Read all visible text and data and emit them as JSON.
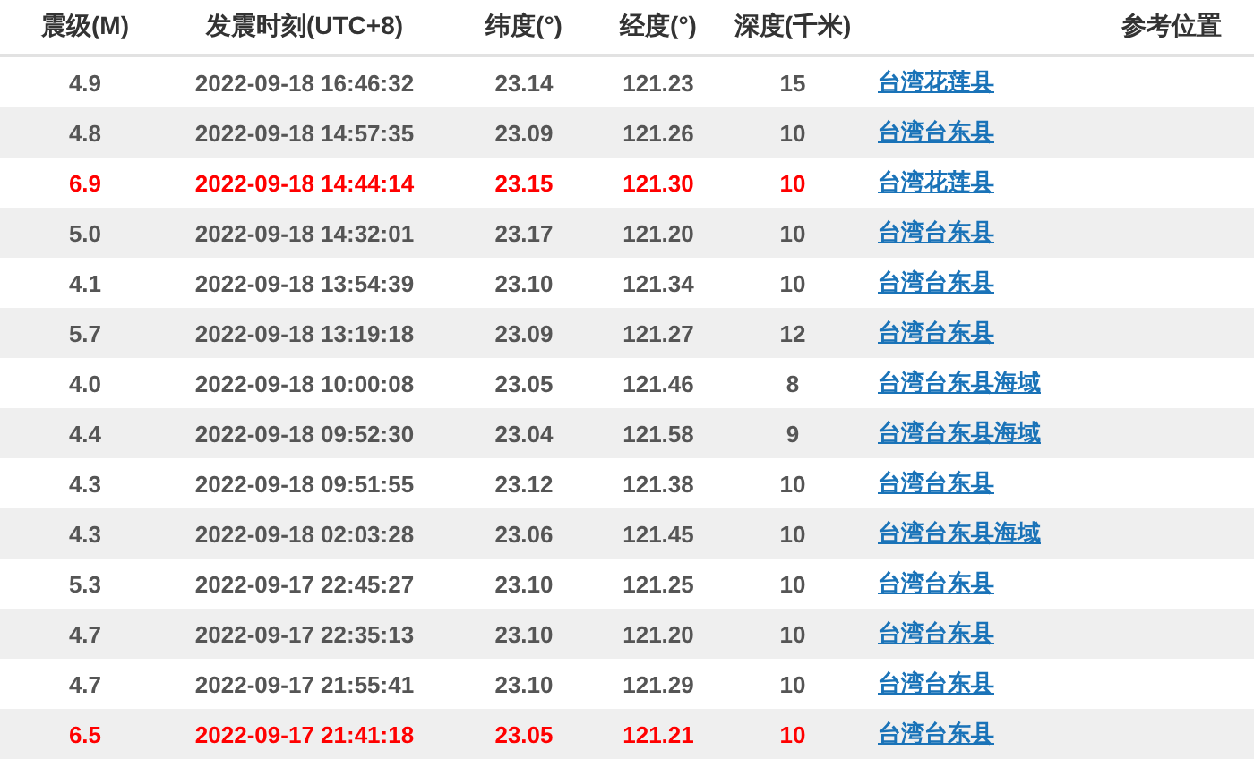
{
  "columns": [
    "震级(M)",
    "发震时刻(UTC+8)",
    "纬度(°)",
    "经度(°)",
    "深度(千米)",
    "参考位置"
  ],
  "rows": [
    {
      "magnitude": "4.9",
      "time": "2022-09-18 16:46:32",
      "latitude": "23.14",
      "longitude": "121.23",
      "depth": "15",
      "location": "台湾花莲县",
      "highlighted": false
    },
    {
      "magnitude": "4.8",
      "time": "2022-09-18 14:57:35",
      "latitude": "23.09",
      "longitude": "121.26",
      "depth": "10",
      "location": "台湾台东县",
      "highlighted": false
    },
    {
      "magnitude": "6.9",
      "time": "2022-09-18 14:44:14",
      "latitude": "23.15",
      "longitude": "121.30",
      "depth": "10",
      "location": "台湾花莲县",
      "highlighted": true
    },
    {
      "magnitude": "5.0",
      "time": "2022-09-18 14:32:01",
      "latitude": "23.17",
      "longitude": "121.20",
      "depth": "10",
      "location": "台湾台东县",
      "highlighted": false
    },
    {
      "magnitude": "4.1",
      "time": "2022-09-18 13:54:39",
      "latitude": "23.10",
      "longitude": "121.34",
      "depth": "10",
      "location": "台湾台东县",
      "highlighted": false
    },
    {
      "magnitude": "5.7",
      "time": "2022-09-18 13:19:18",
      "latitude": "23.09",
      "longitude": "121.27",
      "depth": "12",
      "location": "台湾台东县",
      "highlighted": false
    },
    {
      "magnitude": "4.0",
      "time": "2022-09-18 10:00:08",
      "latitude": "23.05",
      "longitude": "121.46",
      "depth": "8",
      "location": "台湾台东县海域",
      "highlighted": false
    },
    {
      "magnitude": "4.4",
      "time": "2022-09-18 09:52:30",
      "latitude": "23.04",
      "longitude": "121.58",
      "depth": "9",
      "location": "台湾台东县海域",
      "highlighted": false
    },
    {
      "magnitude": "4.3",
      "time": "2022-09-18 09:51:55",
      "latitude": "23.12",
      "longitude": "121.38",
      "depth": "10",
      "location": "台湾台东县",
      "highlighted": false
    },
    {
      "magnitude": "4.3",
      "time": "2022-09-18 02:03:28",
      "latitude": "23.06",
      "longitude": "121.45",
      "depth": "10",
      "location": "台湾台东县海域",
      "highlighted": false
    },
    {
      "magnitude": "5.3",
      "time": "2022-09-17 22:45:27",
      "latitude": "23.10",
      "longitude": "121.25",
      "depth": "10",
      "location": "台湾台东县",
      "highlighted": false
    },
    {
      "magnitude": "4.7",
      "time": "2022-09-17 22:35:13",
      "latitude": "23.10",
      "longitude": "121.20",
      "depth": "10",
      "location": "台湾台东县",
      "highlighted": false
    },
    {
      "magnitude": "4.7",
      "time": "2022-09-17 21:55:41",
      "latitude": "23.10",
      "longitude": "121.29",
      "depth": "10",
      "location": "台湾台东县",
      "highlighted": false
    },
    {
      "magnitude": "6.5",
      "time": "2022-09-17 21:41:18",
      "latitude": "23.05",
      "longitude": "121.21",
      "depth": "10",
      "location": "台湾台东县",
      "highlighted": true
    }
  ]
}
